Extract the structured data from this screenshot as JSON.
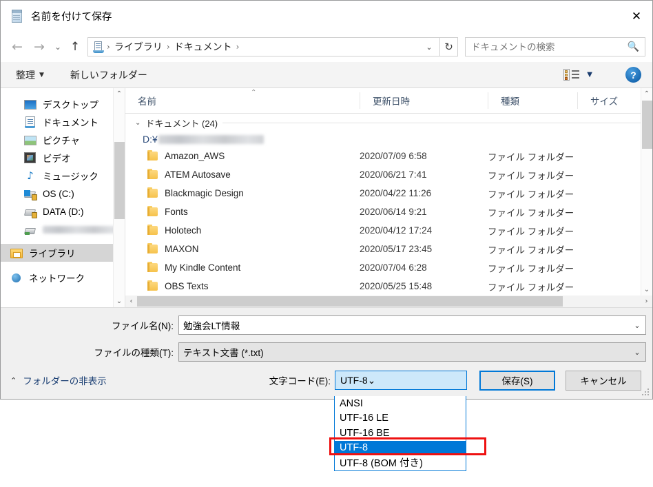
{
  "window": {
    "title": "名前を付けて保存",
    "title_icon": "notepad-icon",
    "close_label": "✕"
  },
  "nav": {
    "back": "←",
    "forward": "→",
    "recent": "⌄",
    "up": "↑",
    "breadcrumbs": [
      "ライブラリ",
      "ドキュメント"
    ],
    "separator": "›",
    "address_chevron": "⌄",
    "refresh": "↻"
  },
  "search": {
    "placeholder": "ドキュメントの検索",
    "value": "",
    "icon": "magnifier-icon"
  },
  "command_bar": {
    "organize": "整理",
    "organize_caret": "▼",
    "new_folder": "新しいフォルダー",
    "view_caret": "▼",
    "help": "?"
  },
  "sidebar": {
    "items": [
      {
        "label": "デスクトップ",
        "icon": "desktop-icon",
        "selected": false,
        "root": false,
        "blurred": false
      },
      {
        "label": "ドキュメント",
        "icon": "document-icon",
        "selected": false,
        "root": false,
        "blurred": false
      },
      {
        "label": "ピクチャ",
        "icon": "pictures-icon",
        "selected": false,
        "root": false,
        "blurred": false
      },
      {
        "label": "ビデオ",
        "icon": "videos-icon",
        "selected": false,
        "root": false,
        "blurred": false
      },
      {
        "label": "ミュージック",
        "icon": "music-icon",
        "selected": false,
        "root": false,
        "blurred": false
      },
      {
        "label": "OS (C:)",
        "icon": "windows-drive-locked-icon",
        "selected": false,
        "root": false,
        "blurred": false
      },
      {
        "label": "DATA (D:)",
        "icon": "drive-locked-icon",
        "selected": false,
        "root": false,
        "blurred": false
      },
      {
        "label": "",
        "icon": "network-drive-icon",
        "selected": false,
        "root": false,
        "blurred": true
      },
      {
        "label": "ライブラリ",
        "icon": "library-folder-icon",
        "selected": true,
        "root": true,
        "blurred": false
      },
      {
        "label": "ネットワーク",
        "icon": "network-icon",
        "selected": false,
        "root": true,
        "blurred": false
      }
    ],
    "scroll_up": "⌃",
    "scroll_down": "⌄"
  },
  "file_list": {
    "columns": [
      "名前",
      "更新日時",
      "種類",
      "サイズ"
    ],
    "sort_indicator": "⌃",
    "group": {
      "caret": "⌄",
      "label": "ドキュメント (24)",
      "path_prefix": "D:¥",
      "path_blurred": true
    },
    "rows": [
      {
        "name": "Amazon_AWS",
        "date": "2020/07/09 6:58",
        "type": "ファイル フォルダー",
        "size": ""
      },
      {
        "name": "ATEM Autosave",
        "date": "2020/06/21 7:41",
        "type": "ファイル フォルダー",
        "size": ""
      },
      {
        "name": "Blackmagic Design",
        "date": "2020/04/22 11:26",
        "type": "ファイル フォルダー",
        "size": ""
      },
      {
        "name": "Fonts",
        "date": "2020/06/14 9:21",
        "type": "ファイル フォルダー",
        "size": ""
      },
      {
        "name": "Holotech",
        "date": "2020/04/12 17:24",
        "type": "ファイル フォルダー",
        "size": ""
      },
      {
        "name": "MAXON",
        "date": "2020/05/17 23:45",
        "type": "ファイル フォルダー",
        "size": ""
      },
      {
        "name": "My Kindle Content",
        "date": "2020/07/04 6:28",
        "type": "ファイル フォルダー",
        "size": ""
      },
      {
        "name": "OBS Texts",
        "date": "2020/05/25 15:48",
        "type": "ファイル フォルダー",
        "size": ""
      }
    ],
    "vscroll_up": "⌃",
    "vscroll_down": "⌄",
    "hscroll_left": "‹",
    "hscroll_right": "›"
  },
  "form": {
    "filename_label": "ファイル名(N):",
    "filename_value": "勉強会LT情報",
    "filetype_label": "ファイルの種類(T):",
    "filetype_value": "テキスト文書 (*.txt)",
    "combo_chevron": "⌄"
  },
  "footer": {
    "hide_folders_caret": "⌃",
    "hide_folders": "フォルダーの非表示",
    "encoding_label": "文字コード(E):",
    "encoding_value": "UTF-8",
    "encoding_chevron": "⌄",
    "save_label": "保存(S)",
    "cancel_label": "キャンセル"
  },
  "encoding_dropdown": {
    "open": true,
    "options": [
      "ANSI",
      "UTF-16 LE",
      "UTF-16 BE",
      "UTF-8",
      "UTF-8 (BOM 付き)"
    ],
    "selected_index": 3,
    "highlight_color": "#0078d7",
    "annotation_box_color": "#ee1111"
  }
}
